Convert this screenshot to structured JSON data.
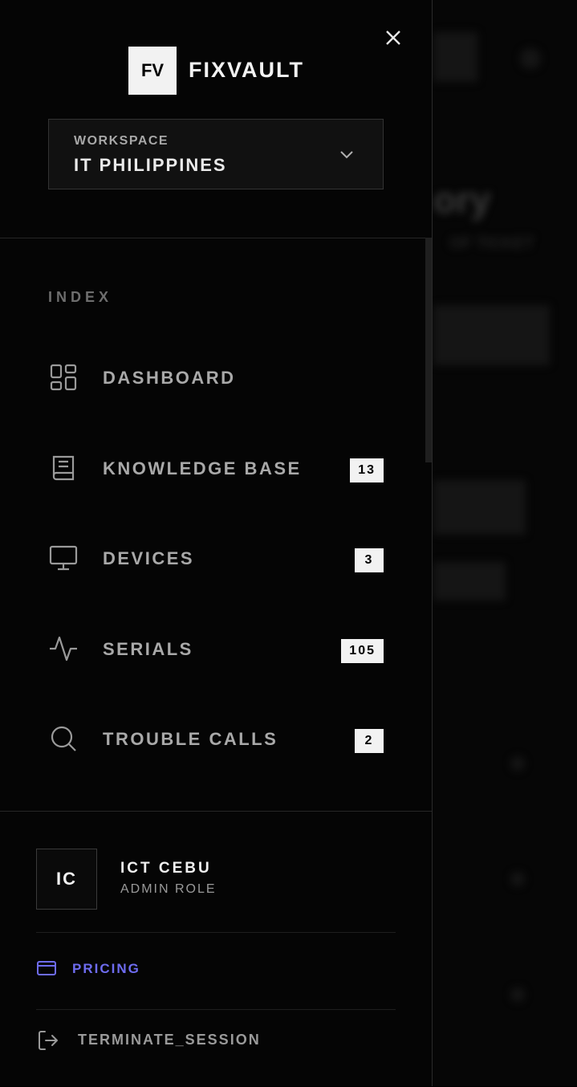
{
  "brand": {
    "logo_initials": "FV",
    "name": "FIXVAULT"
  },
  "workspace": {
    "label": "WORKSPACE",
    "value": "IT PHILIPPINES"
  },
  "index_label": "INDEX",
  "nav": [
    {
      "label": "DASHBOARD",
      "icon": "dashboard-icon",
      "badge": ""
    },
    {
      "label": "KNOWLEDGE BASE",
      "icon": "book-icon",
      "badge": "13"
    },
    {
      "label": "DEVICES",
      "icon": "monitor-icon",
      "badge": "3"
    },
    {
      "label": "SERIALS",
      "icon": "activity-icon",
      "badge": "105"
    },
    {
      "label": "TROUBLE CALLS",
      "icon": "search-icon",
      "badge": "2"
    }
  ],
  "user": {
    "initials": "IC",
    "name": "ICT CEBU",
    "role": "ADMIN ROLE"
  },
  "pricing": {
    "label": "PRICING",
    "color": "#6e6cf0"
  },
  "logout": {
    "label": "TERMINATE_SESSION"
  },
  "colors": {
    "background": "#050505",
    "badge_bg": "#f2f2f2",
    "accent": "#6e6cf0"
  }
}
